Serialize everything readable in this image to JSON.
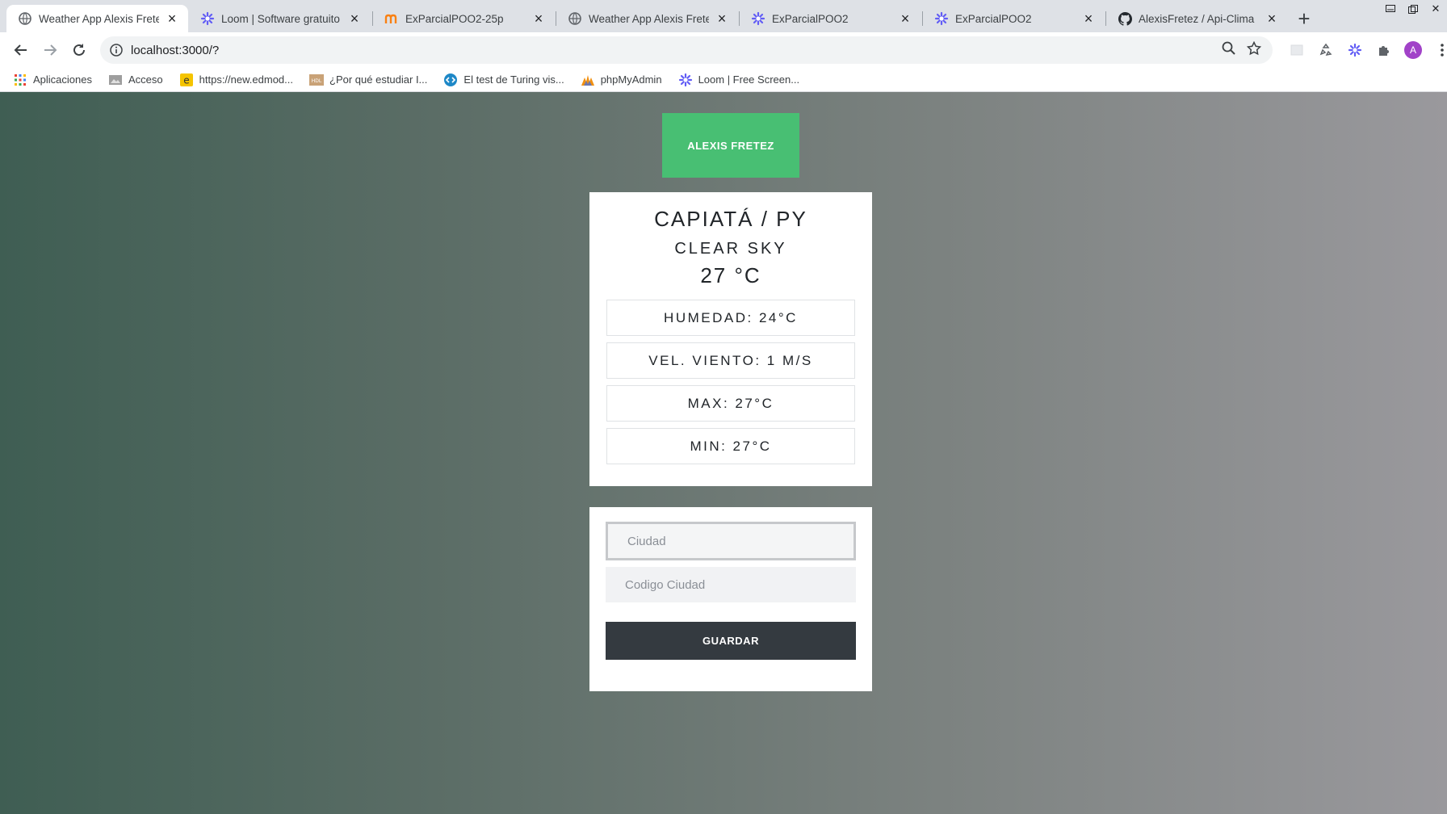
{
  "browser": {
    "tabs": [
      {
        "title": "Weather App Alexis Frete",
        "icon": "globe-icon",
        "active": true
      },
      {
        "title": "Loom | Software gratuito",
        "icon": "loom-icon",
        "active": false
      },
      {
        "title": "ExParcialPOO2-25p",
        "icon": "moodle-icon",
        "active": false
      },
      {
        "title": "Weather App Alexis Frete",
        "icon": "globe-icon",
        "active": false
      },
      {
        "title": "ExParcialPOO2",
        "icon": "loom-icon",
        "active": false
      },
      {
        "title": "ExParcialPOO2",
        "icon": "loom-icon",
        "active": false
      },
      {
        "title": "AlexisFretez / Api-Clima",
        "icon": "github-icon",
        "active": false
      }
    ],
    "url": "localhost:3000/?",
    "avatar_letter": "A",
    "bookmarks": [
      {
        "label": "Aplicaciones",
        "icon": "apps-grid-icon"
      },
      {
        "label": "Acceso",
        "icon": "folder-image-icon"
      },
      {
        "label": "https://new.edmod...",
        "icon": "edmodo-icon"
      },
      {
        "label": "¿Por qué estudiar I...",
        "icon": "hdl-icon"
      },
      {
        "label": "El test de Turing vis...",
        "icon": "code-icon"
      },
      {
        "label": "phpMyAdmin",
        "icon": "phpmyadmin-icon"
      },
      {
        "label": "Loom | Free Screen...",
        "icon": "loom-icon"
      }
    ]
  },
  "app": {
    "author_button": "ALEXIS FRETEZ",
    "weather": {
      "location": "CAPIATÁ / PY",
      "description": "CLEAR SKY",
      "temperature": "27 °C",
      "humidity": "HUMEDAD: 24°C",
      "wind": "VEL. VIENTO: 1 M/S",
      "max": "MAX: 27°C",
      "min": "MIN: 27°C"
    },
    "form": {
      "city_placeholder": "Ciudad",
      "code_placeholder": "Codigo Ciudad",
      "save_label": "GUARDAR"
    }
  },
  "colors": {
    "accent_green": "#48bf73",
    "button_dark": "#343a40"
  }
}
